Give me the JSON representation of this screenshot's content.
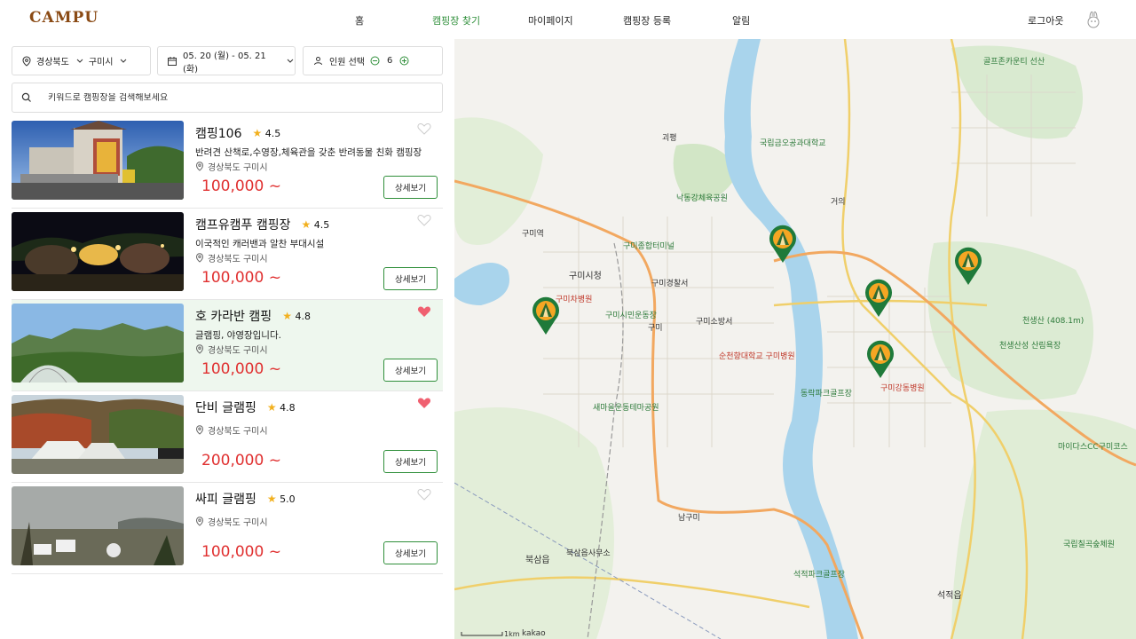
{
  "header": {
    "logo": "CAMPU",
    "nav": [
      {
        "label": "홈",
        "name": "nav-home",
        "active": false
      },
      {
        "label": "캠핑장 찾기",
        "name": "nav-find-campsite",
        "active": true
      },
      {
        "label": "마이페이지",
        "name": "nav-mypage",
        "active": false
      },
      {
        "label": "캠핑장 등록",
        "name": "nav-register-campsite",
        "active": false
      },
      {
        "label": "알림",
        "name": "nav-notifications",
        "active": false
      }
    ],
    "logout": "로그아웃"
  },
  "filters": {
    "province": "경상북도",
    "city": "구미시",
    "dates": "05. 20 (월) - 05. 21 (화)",
    "people_label": "인원 선택",
    "people_count": "6"
  },
  "search": {
    "placeholder": "키워드로 캠핑장을 검색해보세요"
  },
  "listings": [
    {
      "name": "캠핑106",
      "rating": "4.5",
      "desc": "반려견 산책로,수영장,체육관을 갖춘 반려동물 친화 캠핑장",
      "location": "경상북도 구미시",
      "price": "100,000 ~",
      "liked": false,
      "button": "상세보기",
      "highlight": false
    },
    {
      "name": "캠프유캠푸 캠핑장",
      "rating": "4.5",
      "desc": "이국적인 캐러밴과 알찬 부대시설",
      "location": "경상북도 구미시",
      "price": "100,000 ~",
      "liked": false,
      "button": "상세보기",
      "highlight": false
    },
    {
      "name": "호 카라반 캠핑",
      "rating": "4.8",
      "desc": "글램핑, 야영장입니다.",
      "location": "경상북도 구미시",
      "price": "100,000 ~",
      "liked": true,
      "button": "상세보기",
      "highlight": true
    },
    {
      "name": "단비 글램핑",
      "rating": "4.8",
      "desc": "",
      "location": "경상북도 구미시",
      "price": "200,000 ~",
      "liked": true,
      "button": "상세보기",
      "highlight": false
    },
    {
      "name": "싸피 글램핑",
      "rating": "5.0",
      "desc": "",
      "location": "경상북도 구미시",
      "price": "100,000 ~",
      "liked": false,
      "button": "상세보기",
      "highlight": false
    }
  ],
  "map": {
    "labels": [
      {
        "text": "구미역",
        "cls": ""
      },
      {
        "text": "구미시청",
        "cls": ""
      },
      {
        "text": "구미종합터미널",
        "cls": "g"
      },
      {
        "text": "구미경찰서",
        "cls": ""
      },
      {
        "text": "구미소방서",
        "cls": ""
      },
      {
        "text": "순천향대학교 구미병원",
        "cls": "r"
      },
      {
        "text": "구미시민운동장",
        "cls": "g"
      },
      {
        "text": "낙동강체육공원",
        "cls": "g"
      },
      {
        "text": "국립금오공과대학교",
        "cls": "g"
      },
      {
        "text": "구미강동병원",
        "cls": "r"
      },
      {
        "text": "천생산 (408.1m)",
        "cls": "g"
      },
      {
        "text": "천생산성 산림욕장",
        "cls": "g"
      },
      {
        "text": "마이다스CC구미코스",
        "cls": "g"
      },
      {
        "text": "국립칠곡숲체원",
        "cls": "g"
      },
      {
        "text": "남구미",
        "cls": ""
      },
      {
        "text": "북삼읍",
        "cls": ""
      },
      {
        "text": "북삼읍사무소",
        "cls": ""
      },
      {
        "text": "석적읍",
        "cls": ""
      },
      {
        "text": "골프존카운티 선산",
        "cls": "g"
      },
      {
        "text": "동락파크골프장",
        "cls": "g"
      },
      {
        "text": "새마을운동테마공원",
        "cls": "g"
      },
      {
        "text": "석적파크골프장",
        "cls": "g"
      },
      {
        "text": "구미차병원",
        "cls": "r"
      },
      {
        "text": "괴평",
        "cls": ""
      },
      {
        "text": "거의",
        "cls": ""
      },
      {
        "text": "구미",
        "cls": ""
      }
    ],
    "scale": "1km",
    "brand": "kakao"
  },
  "colors": {
    "accent": "#2f8f3a",
    "price": "#e03030",
    "heart": "#f06070",
    "star": "#f2b01e",
    "logo": "#8a4a14"
  }
}
